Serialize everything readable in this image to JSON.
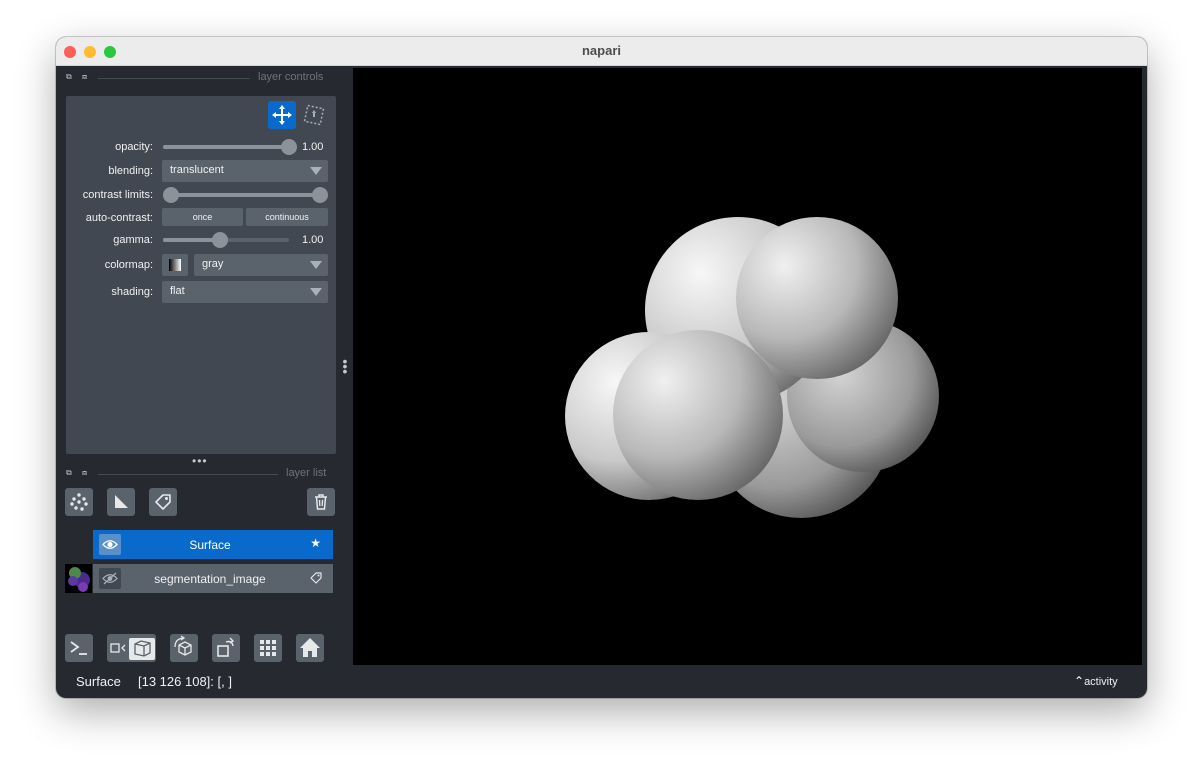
{
  "app": {
    "title": "napari"
  },
  "layer_controls": {
    "title": "layer controls",
    "opacity": {
      "label": "opacity:",
      "value": "1.00",
      "fraction": 1.0
    },
    "blending": {
      "label": "blending:",
      "value": "translucent"
    },
    "contrast_limits": {
      "label": "contrast limits:",
      "low_fraction": 0.0,
      "high_fraction": 1.0
    },
    "auto_contrast": {
      "label": "auto-contrast:",
      "once": "once",
      "continuous": "continuous"
    },
    "gamma": {
      "label": "gamma:",
      "value": "1.00",
      "fraction": 0.45
    },
    "colormap": {
      "label": "colormap:",
      "value": "gray"
    },
    "shading": {
      "label": "shading:",
      "value": "flat"
    }
  },
  "layer_list": {
    "title": "layer list",
    "layers": [
      {
        "name": "Surface",
        "selected": true,
        "visible": true
      },
      {
        "name": "segmentation_image",
        "selected": false,
        "visible": false
      }
    ]
  },
  "viewer_buttons": [
    "console-icon",
    "ndisplay-toggle-icon",
    "roll-dims-icon",
    "transpose-icon",
    "grid-icon",
    "home-icon"
  ],
  "status": {
    "layer": "Surface",
    "coords": "[13 126 108]: [, ]",
    "activity": "activity"
  },
  "colors": {
    "accent": "#0a6acb",
    "panel": "#414851",
    "background": "#262930",
    "control": "#5a626c"
  }
}
